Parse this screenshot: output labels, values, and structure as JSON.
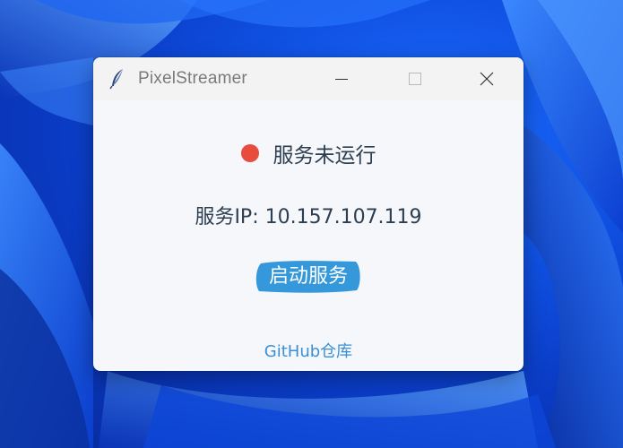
{
  "window": {
    "title": "PixelStreamer",
    "app_icon": "feather-icon"
  },
  "caption_buttons": {
    "minimize_icon": "minimize-icon",
    "maximize_icon": "maximize-icon",
    "close_icon": "close-icon"
  },
  "status": {
    "text": "服务未运行",
    "indicator_color": "#e74c3c"
  },
  "server": {
    "ip_text": "服务IP: 10.157.107.119"
  },
  "actions": {
    "start_label": "启动服务",
    "button_color": "#3498db"
  },
  "footer": {
    "link_text": "GitHub仓库",
    "link_color": "#3a8fd6"
  }
}
